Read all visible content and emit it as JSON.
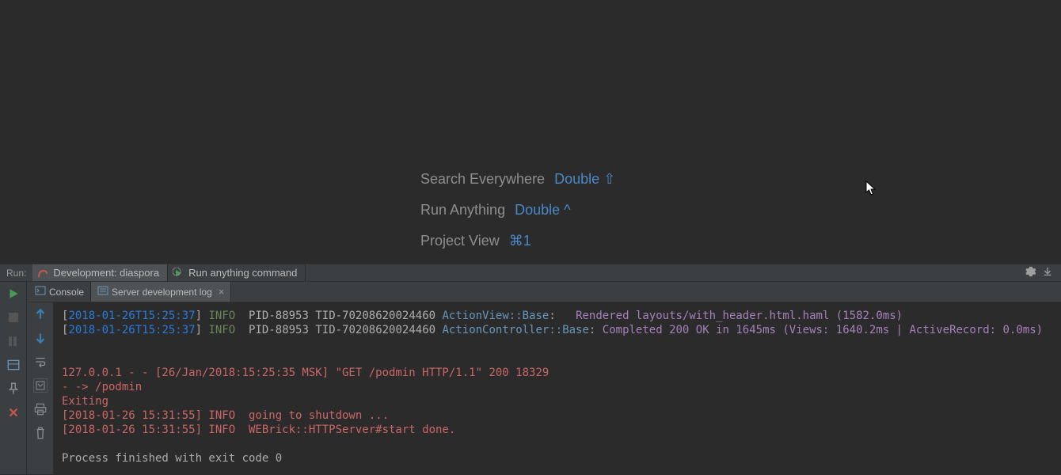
{
  "hints": [
    {
      "label": "Search Everywhere",
      "key": "Double ⇧"
    },
    {
      "label": "Run Anything",
      "key": "Double ^"
    },
    {
      "label": "Project View",
      "key": "⌘1"
    }
  ],
  "runHeader": {
    "label": "Run:",
    "tabs": [
      {
        "label": "Development: diaspora"
      },
      {
        "label": "Run anything command"
      }
    ]
  },
  "subtabs": {
    "console": "Console",
    "log": "Server development log"
  },
  "console": {
    "line1": {
      "bracket": "[",
      "ts": "2018-01-26T15:25:37",
      "bracket2": "]",
      "level": "INFO",
      "pid": "  PID-88953 TID-70208620024460 ",
      "cls": "ActionView::Base",
      "colon": ":",
      "pad": "   ",
      "msg": "Rendered layouts/with_header.html.haml (1582.0ms)"
    },
    "line2": {
      "bracket": "[",
      "ts": "2018-01-26T15:25:37",
      "bracket2": "]",
      "level": "INFO",
      "pid": "  PID-88953 TID-70208620024460 ",
      "cls": "ActionController::Base",
      "colon": ": ",
      "msg": "Completed 200 OK in 1645ms (Views: 1640.2ms | ActiveRecord: 0.0ms)"
    },
    "blank1": " ",
    "blank2": " ",
    "red1": "127.0.0.1 - - [26/Jan/2018:15:25:35 MSK] \"GET /podmin HTTP/1.1\" 200 18329",
    "red2": "- -> /podmin",
    "red3": "Exiting",
    "red4": "[2018-01-26 15:31:55] INFO  going to shutdown ...",
    "red5": "[2018-01-26 15:31:55] INFO  WEBrick::HTTPServer#start done.",
    "exitLine": "Process finished with exit code 0"
  }
}
